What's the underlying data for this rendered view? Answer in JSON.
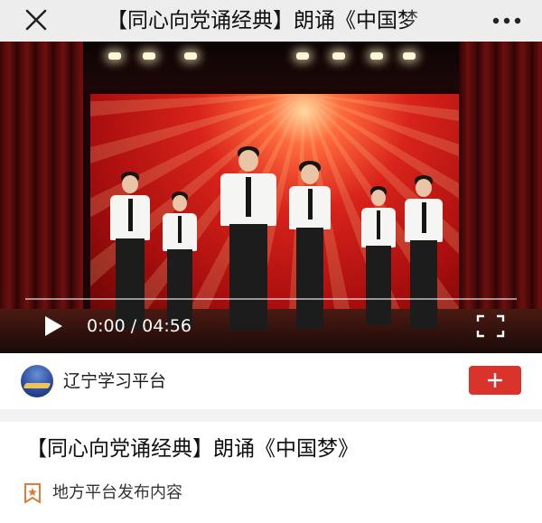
{
  "topbar": {
    "close_icon": "close-icon",
    "title": "【同心向党诵经典】朗诵《中国梦",
    "more_icon": "more-dots-icon"
  },
  "video": {
    "time_current": "0:00",
    "time_separator": "/",
    "time_total": "04:56",
    "progress": 0,
    "play_icon": "play-icon",
    "fullscreen_icon": "fullscreen-icon"
  },
  "channel": {
    "name": "辽宁学习平台",
    "follow_icon": "plus-icon",
    "follow_color": "#d9332b"
  },
  "article": {
    "title": "【同心向党诵经典】朗诵《中国梦》",
    "tag_text": "地方平台发布内容",
    "tag_icon": "bookmark-star-icon",
    "tag_color": "#e07b39"
  }
}
